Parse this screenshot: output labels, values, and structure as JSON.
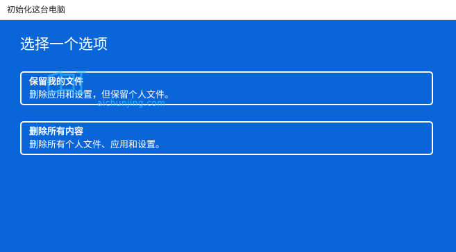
{
  "window": {
    "title": "初始化这台电脑"
  },
  "main": {
    "heading": "选择一个选项",
    "options": [
      {
        "title": "保留我的文件",
        "description": "删除应用和设置，但保留个人文件。"
      },
      {
        "title": "删除所有内容",
        "description": "删除所有个人文件、应用和设置。"
      }
    ]
  },
  "watermark": {
    "text": "aichunjing.com",
    "logo_icon": "watermark-logo-icon"
  },
  "colors": {
    "background": "#0a66d8",
    "titlebar": "#ffffff",
    "text": "#ffffff",
    "watermark": "#3cc4ff"
  }
}
